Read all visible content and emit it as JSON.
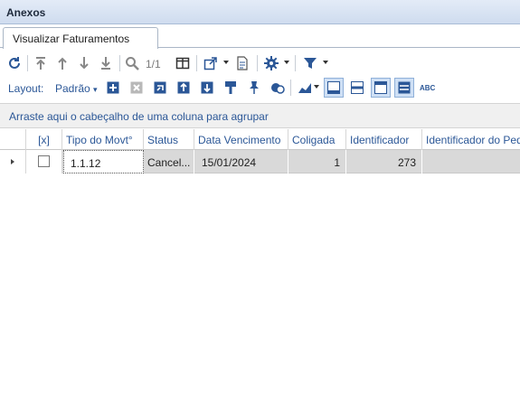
{
  "window": {
    "title": "Anexos"
  },
  "tabs": [
    {
      "label": "Visualizar Faturamentos",
      "active": true
    }
  ],
  "toolbar": {
    "paging": "1/1",
    "icons": [
      "refresh-icon",
      "move-first-icon",
      "move-up-icon",
      "move-down-icon",
      "move-last-icon",
      "search-icon",
      "split-view-icon",
      "export-icon",
      "report-icon",
      "gear-icon",
      "filter-icon"
    ]
  },
  "layout": {
    "label": "Layout:",
    "selected": "Padrão",
    "icons": [
      "add-icon",
      "delete-icon",
      "apply-icon",
      "upload-icon",
      "download-icon",
      "paint-brush-icon",
      "pin-icon",
      "shapes-icon",
      "chart-icon",
      "view-mode-1-icon",
      "view-mode-2-icon",
      "view-mode-3-icon",
      "view-mode-4-icon",
      "abc-icon"
    ]
  },
  "groupbar": {
    "text": "Arraste aqui o cabeçalho de uma coluna para agrupar"
  },
  "grid": {
    "columns": [
      "[x]",
      "Tipo do Movt°",
      "Status",
      "Data Vencimento",
      "Coligada",
      "Identificador",
      "Identificador do Pedido"
    ],
    "rows": [
      {
        "checked": false,
        "tipo": "1.1.12",
        "status": "Cancel...",
        "vencimento": "15/01/2024",
        "coligada": "1",
        "identificador": "273",
        "pedido": ""
      }
    ]
  },
  "colors": {
    "accent": "#2b5797",
    "titlebar": "#d3dff0",
    "row_bg": "#d9d9d9"
  }
}
